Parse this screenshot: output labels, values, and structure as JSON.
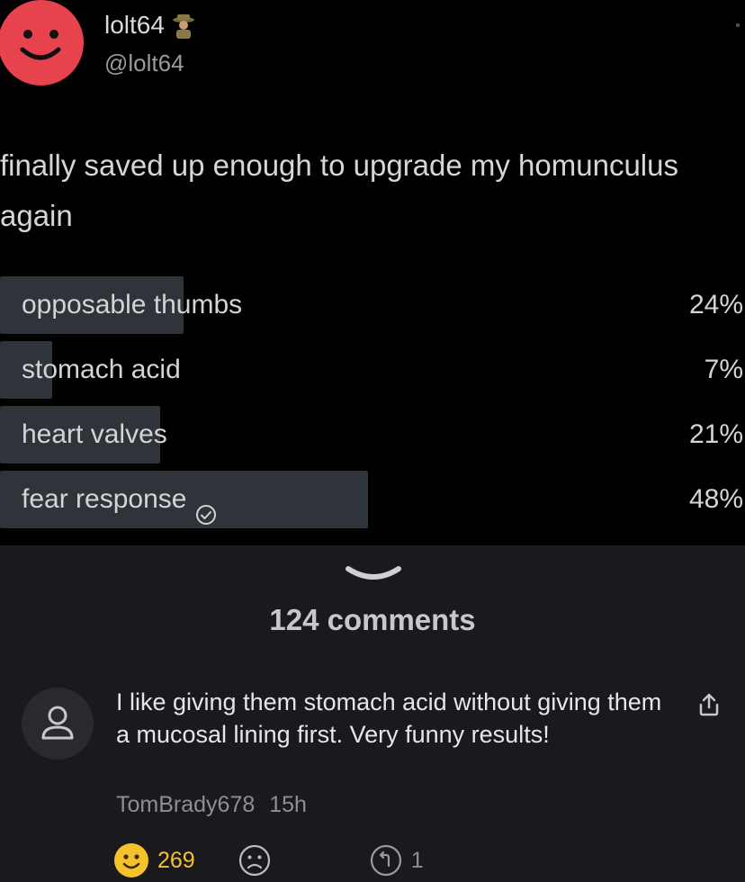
{
  "post": {
    "username": "lolt64",
    "handle": "@lolt64",
    "text": "finally saved up enough to upgrade my homunculus again",
    "poll": [
      {
        "label": "opposable thumbs",
        "percent": "24%",
        "fill": 0.24,
        "voted": false
      },
      {
        "label": "stomach acid",
        "percent": "7%",
        "fill": 0.07,
        "voted": false
      },
      {
        "label": "heart valves",
        "percent": "21%",
        "fill": 0.21,
        "voted": false
      },
      {
        "label": "fear response",
        "percent": "48%",
        "fill": 0.48,
        "voted": true
      }
    ]
  },
  "comments": {
    "count_label": "124 comments",
    "first": {
      "text": "I like giving them stomach acid without giving them a mucosal lining first. Very funny results!",
      "author": "TomBrady678",
      "time": "15h",
      "likes": "269",
      "replies": "1"
    }
  },
  "colors": {
    "avatar": "#e6434e",
    "poll_fill": "#2e3439",
    "background_top": "#000000",
    "background_bottom": "#1a191e",
    "reaction_yellow": "#f5c22b"
  },
  "icons": [
    "smiley-avatar-icon",
    "detective-badge-icon",
    "checkmark-circle-icon",
    "chevron-down-icon",
    "user-avatar-icon",
    "share-icon",
    "smile-reaction-icon",
    "sad-reaction-icon",
    "reply-icon"
  ]
}
